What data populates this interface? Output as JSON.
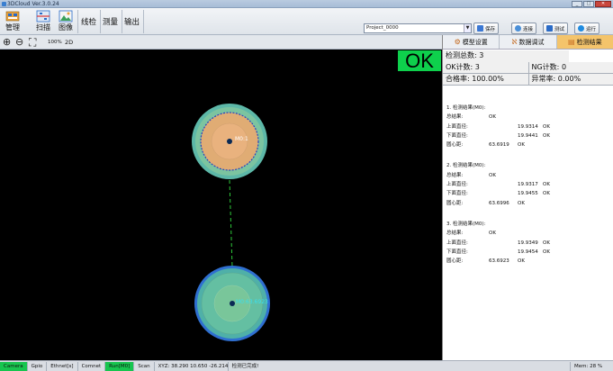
{
  "window": {
    "title": "3DCloud Ver.3.0.24",
    "min": "_",
    "max": "□",
    "close": "✕"
  },
  "ribbon": {
    "manage": "管理",
    "scan": "扫描",
    "image": "图像",
    "line_check": "线检",
    "measure": "测量",
    "output": "输出",
    "project": "Project_0000",
    "save": "保存",
    "connect": "连接",
    "test": "测试",
    "run": "运行"
  },
  "toolbar": {
    "zoom_level": "100%",
    "view_mode": "2D"
  },
  "tabs": [
    {
      "label": "模型设置",
      "active": false
    },
    {
      "label": "数据调试",
      "active": false
    },
    {
      "label": "检测结果",
      "active": true
    }
  ],
  "stats": {
    "total_label": "检测总数:",
    "total": "3",
    "ok_label": "OK计数:",
    "ok": "3",
    "ng_label": "NG计数:",
    "ng": "0",
    "pass_label": "合格率:",
    "pass": "100.00%",
    "abn_label": "异常率:",
    "abn": "0.00%"
  },
  "result_badge": "OK",
  "results": [
    {
      "header": "1. 检测结果(M0):",
      "overall_label": "总结果:",
      "overall": "OK",
      "upper_label": "上面直径:",
      "upper": "19.9314",
      "upper_status": "OK",
      "lower_label": "下面直径:",
      "lower": "19.9441",
      "lower_status": "OK",
      "center_label": "圆心距:",
      "center": "63.6919",
      "center_status": "OK"
    },
    {
      "header": "2. 检测结果(M0):",
      "overall_label": "总结果:",
      "overall": "OK",
      "upper_label": "上面直径:",
      "upper": "19.9317",
      "upper_status": "OK",
      "lower_label": "下面直径:",
      "lower": "19.9455",
      "lower_status": "OK",
      "center_label": "圆心距:",
      "center": "63.6996",
      "center_status": "OK"
    },
    {
      "header": "3. 检测结果(M0):",
      "overall_label": "总结果:",
      "overall": "OK",
      "upper_label": "上面直径:",
      "upper": "19.9349",
      "upper_status": "OK",
      "lower_label": "下面直径:",
      "lower": "19.9454",
      "lower_status": "OK",
      "center_label": "圆心距:",
      "center": "63.6923",
      "center_status": "OK"
    }
  ],
  "viewport": {
    "label_top": "M0:1",
    "label_bottom": "M0:63.6923"
  },
  "statusbar": {
    "camera": "Camera",
    "gpio": "Gpio",
    "ethnet": "Ethnet[s]",
    "comnet": "Comnet",
    "run": "Run[M0]",
    "scan": "Scan",
    "xyz": "XYZ: 38.290  10.650  -26.214",
    "message": "检测已完成!",
    "mem": "Mem: 28 %"
  },
  "colors": {
    "ok_green": "#0ed04c",
    "active_tab": "#f4c46b",
    "status_green": "#17c54f"
  }
}
